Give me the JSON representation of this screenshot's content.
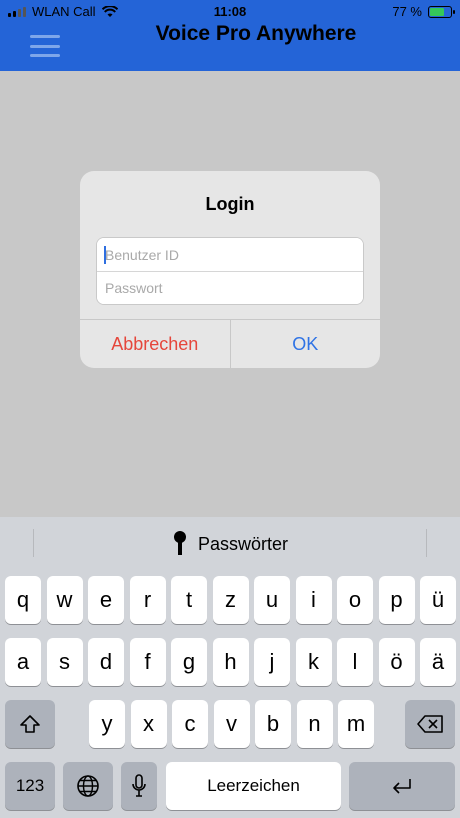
{
  "status_bar": {
    "carrier": "WLAN Call",
    "time": "11:08",
    "battery_text": "77 %",
    "battery_level": 0.77
  },
  "header": {
    "title": "Voice Pro Anywhere",
    "menu_icon": "hamburger-icon"
  },
  "dialog": {
    "title": "Login",
    "user_placeholder": "Benutzer ID",
    "password_placeholder": "Passwort",
    "cancel_label": "Abbrechen",
    "ok_label": "OK"
  },
  "keyboard": {
    "suggestion": "Passwörter",
    "row1": [
      "q",
      "w",
      "e",
      "r",
      "t",
      "z",
      "u",
      "i",
      "o",
      "p",
      "ü"
    ],
    "row2": [
      "a",
      "s",
      "d",
      "f",
      "g",
      "h",
      "j",
      "k",
      "l",
      "ö",
      "ä"
    ],
    "row3": [
      "y",
      "x",
      "c",
      "v",
      "b",
      "n",
      "m"
    ],
    "numbers_label": "123",
    "space_label": "Leerzeichen"
  },
  "colors": {
    "header_bg": "#2464d7",
    "cancel": "#e5463b",
    "ok": "#2f73e5",
    "overlay": "#c8c8c8"
  }
}
